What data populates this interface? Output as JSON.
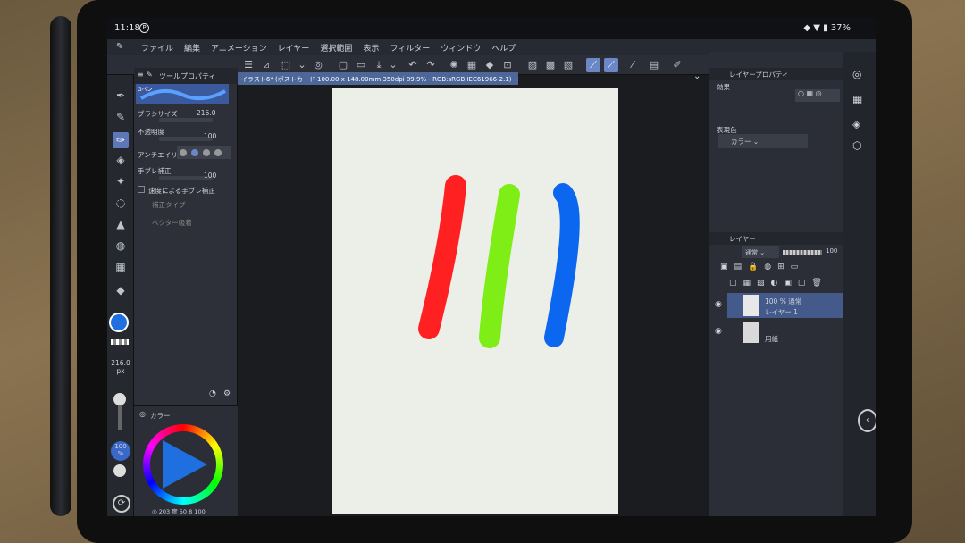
{
  "status": {
    "time": "11:18",
    "chat_icon": "P",
    "battery": "37%"
  },
  "menu": {
    "items": [
      "ファイル",
      "編集",
      "アニメーション",
      "レイヤー",
      "選択範囲",
      "表示",
      "フィルター",
      "ウィンドウ",
      "ヘルプ"
    ]
  },
  "document": {
    "tab_title": "イラスト6* (ポストカード 100.00 x 148.00mm 350dpi 89.9% - RGB:sRGB IEC61966-2.1)",
    "close": "×"
  },
  "tool_property": {
    "title": "ツールプロパティ",
    "preset": "Gペン",
    "brush_size_label": "ブラシサイズ",
    "brush_size_value": "216.0",
    "opacity_label": "不透明度",
    "opacity_value": "100",
    "antialias_label": "アンチエイリ",
    "stabilization_label": "手ブレ補正",
    "stabilization_value": "100",
    "speed_stabilization_label": "速度による手ブレ補正",
    "correction_type_label": "補正タイプ",
    "vector_snap_label": "ベクター吸着"
  },
  "brush_indicator": {
    "size": "216.0",
    "unit": "px",
    "opacity": "100",
    "opacity_unit": "%"
  },
  "color_panel": {
    "title": "カラー",
    "footer": "◎ 203 度  50  8 100"
  },
  "layer_property": {
    "title": "レイヤープロパティ",
    "effect_label": "効果",
    "expression_label": "表現色",
    "expression_value": "カラー"
  },
  "layers_panel": {
    "title": "レイヤー",
    "blend_mode": "通常",
    "opacity": "100",
    "layers": [
      {
        "name": "レイヤー 1",
        "info": "100 % 通常"
      },
      {
        "name": "用紙",
        "info": ""
      }
    ]
  },
  "colors": {
    "main": "#1f6fe0",
    "stroke_red": "#ff2121",
    "stroke_green": "#7fed16",
    "stroke_blue": "#0b66f0",
    "accent": "#5d77b8"
  }
}
